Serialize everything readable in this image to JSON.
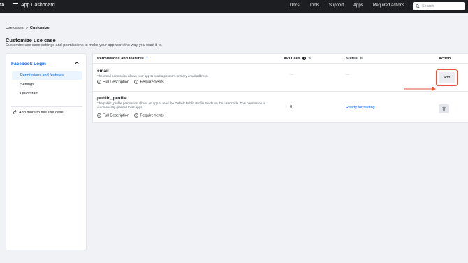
{
  "topbar": {
    "logo_text": "ta",
    "app_title": "App Dashboard",
    "nav": [
      "Docs",
      "Tools",
      "Support",
      "Apps",
      "Required actions"
    ],
    "search_placeholder": "Search"
  },
  "breadcrumb": {
    "first": "Use cases",
    "separator": ">",
    "current": "Customize"
  },
  "page": {
    "title": "Customize use case",
    "subtitle": "Customize use case settings and permissions to make your app work the way you want it to."
  },
  "sidebar": {
    "section": "Facebook Login",
    "items": [
      "Permissions and features",
      "Settings",
      "Quickstart"
    ],
    "add_more": "Add more to this use case"
  },
  "table": {
    "headers": {
      "permissions": "Permissions and features",
      "api_calls": "API Calls",
      "status": "Status",
      "action": "Action"
    },
    "rows": [
      {
        "name": "email",
        "description": "The email permission allows your app to read a person's primary email address.",
        "full_description": "Full Description",
        "requirements": "Requirements",
        "api_calls": "---",
        "status": "---",
        "action": "Add"
      },
      {
        "name": "public_profile",
        "description": "The public_profile permission allows an app to read the Default Public Profile Fields on the User node. This permission is automatically granted to all apps.",
        "full_description": "Full Description",
        "requirements": "Requirements",
        "api_calls": "0",
        "status": "Ready for testing",
        "action_icon": "trash-icon"
      }
    ]
  },
  "colors": {
    "accent": "#0866ff",
    "highlight": "#e2563b",
    "topbar": "#1c1e21"
  }
}
